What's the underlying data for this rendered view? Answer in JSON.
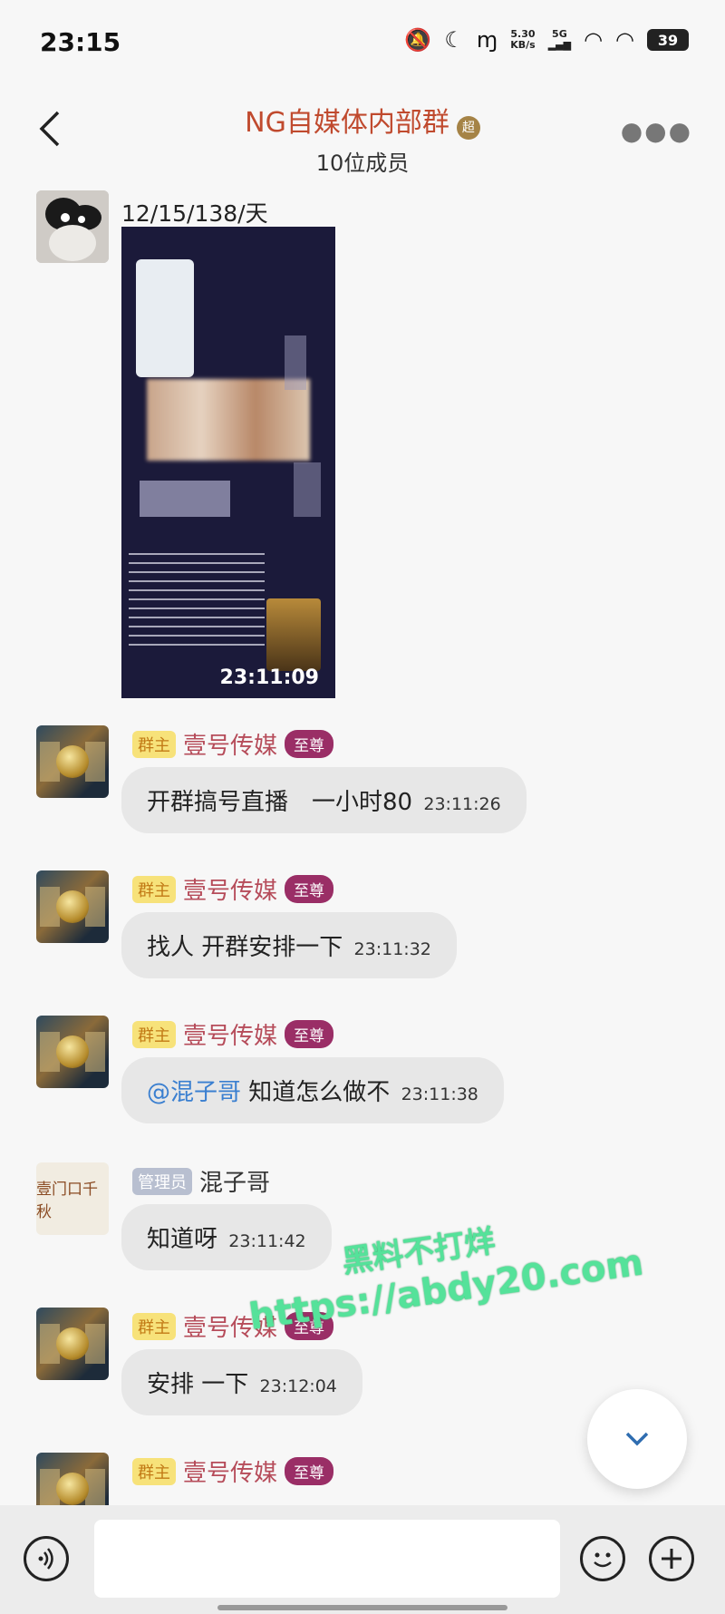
{
  "status_bar": {
    "time": "23:15",
    "net_speed_value": "5.30",
    "net_speed_unit": "KB/s",
    "network": "5G",
    "battery": "39"
  },
  "header": {
    "title": "NG自媒体内部群",
    "title_badge": "超",
    "subtitle": "10位成员"
  },
  "messages": [
    {
      "avatar_type": "cat",
      "caption": "12/15/138/天",
      "image_time": "23:11:09"
    },
    {
      "role": "群主",
      "sender": "壹号传媒",
      "level": "至尊",
      "text": "开群搞号直播　一小时80",
      "time": "23:11:26"
    },
    {
      "role": "群主",
      "sender": "壹号传媒",
      "level": "至尊",
      "text": "找人 开群安排一下",
      "time": "23:11:32"
    },
    {
      "role": "群主",
      "sender": "壹号传媒",
      "level": "至尊",
      "mention": "@混子哥",
      "text": "知道怎么做不",
      "time": "23:11:38"
    },
    {
      "role": "管理员",
      "sender": "混子哥",
      "avatar_text": "壹门口千秋",
      "text": "知道呀",
      "time": "23:11:42"
    },
    {
      "role": "群主",
      "sender": "壹号传媒",
      "level": "至尊",
      "text": "安排 一下",
      "time": "23:12:04"
    },
    {
      "role": "群主",
      "sender": "壹号传媒",
      "level": "至尊"
    }
  ],
  "watermark": {
    "line1": "黑料不打烊",
    "line2": "https://abdy20.com"
  },
  "colors": {
    "title": "#c04a2e",
    "sender": "#b64c5a",
    "level_badge": "#9a2e66",
    "owner_badge": "#f7e27a",
    "watermark": "#55e29a"
  }
}
